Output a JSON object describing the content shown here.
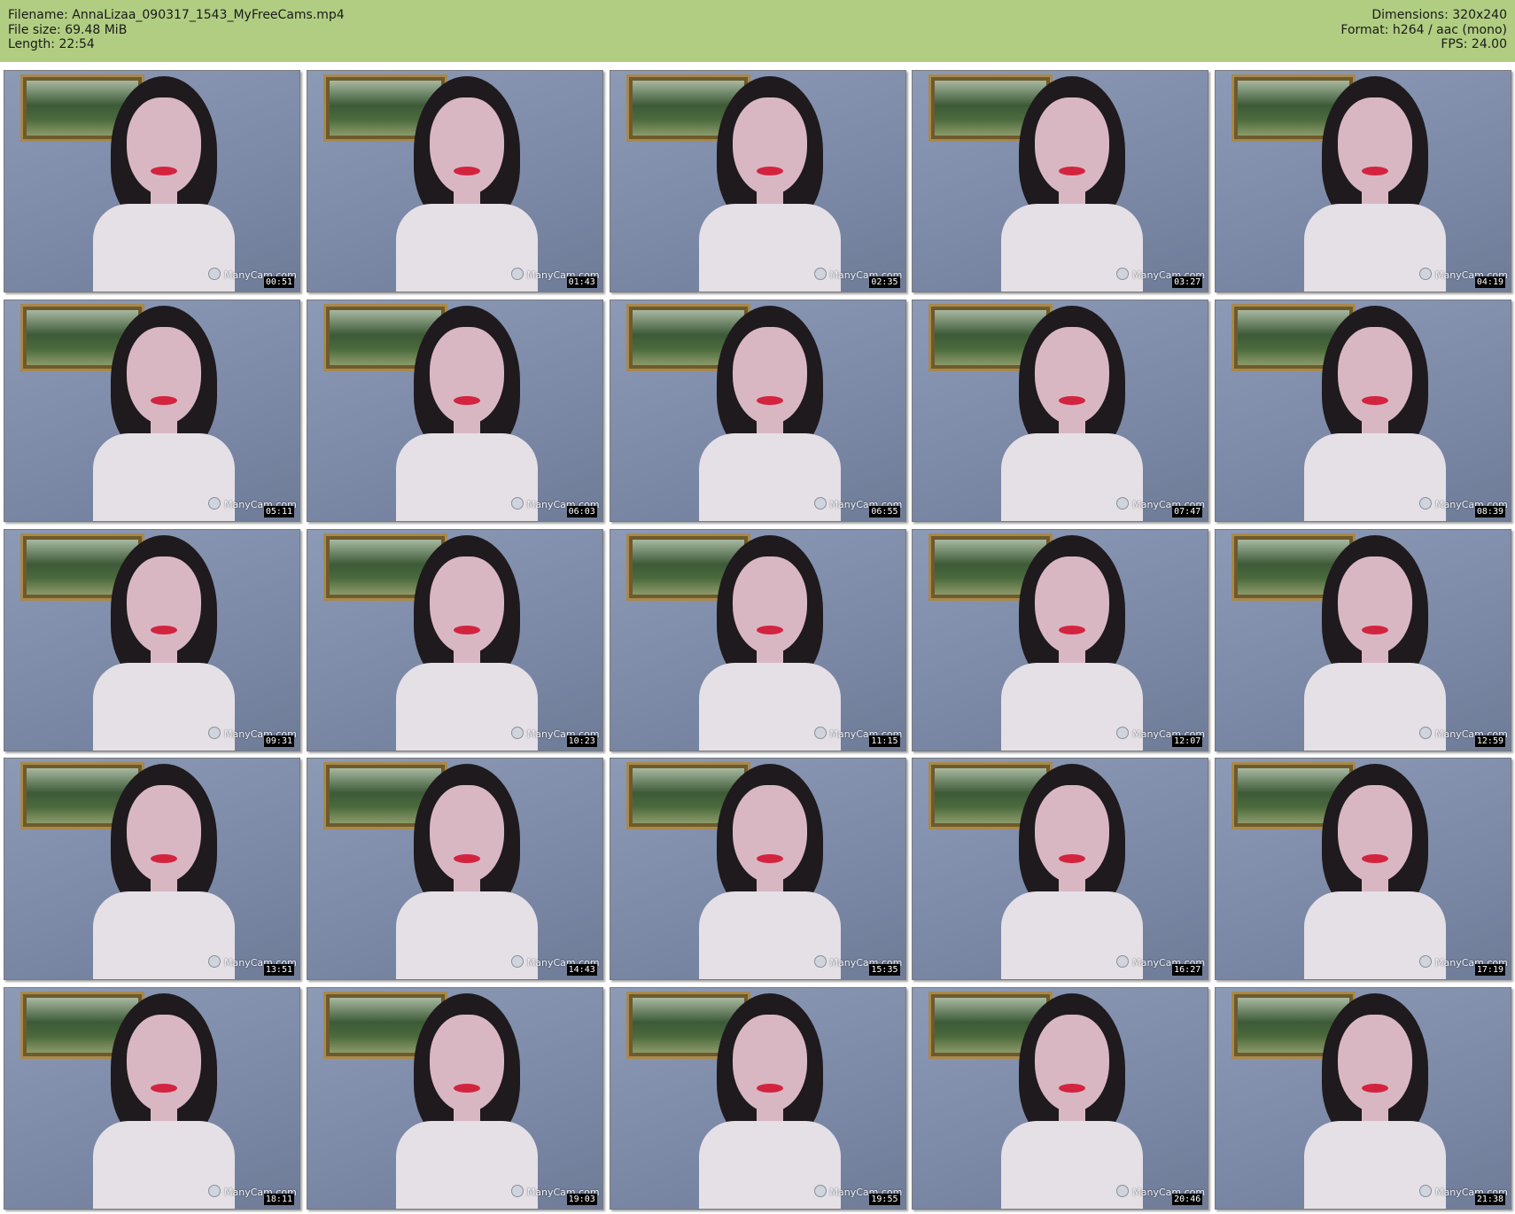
{
  "header": {
    "filename": "Filename: AnnaLizaa_090317_1543_MyFreeCams.mp4",
    "filesize": "File size: 69.48 MiB",
    "length": "Length: 22:54",
    "dimensions": "Dimensions: 320x240",
    "format": "Format: h264 / aac (mono)",
    "fps": "FPS: 24.00"
  },
  "colors": {
    "header_bg": "#b1cd82"
  },
  "thumbnails": [
    {
      "timestamp": "00:51",
      "watermark": "ManyCam.com"
    },
    {
      "timestamp": "01:43",
      "watermark": "ManyCam.com"
    },
    {
      "timestamp": "02:35",
      "watermark": "ManyCam.com"
    },
    {
      "timestamp": "03:27",
      "watermark": "ManyCam.com"
    },
    {
      "timestamp": "04:19",
      "watermark": "ManyCam.com"
    },
    {
      "timestamp": "05:11",
      "watermark": "ManyCam.com"
    },
    {
      "timestamp": "06:03",
      "watermark": "ManyCam.com"
    },
    {
      "timestamp": "06:55",
      "watermark": "ManyCam.com"
    },
    {
      "timestamp": "07:47",
      "watermark": "ManyCam.com"
    },
    {
      "timestamp": "08:39",
      "watermark": "ManyCam.com"
    },
    {
      "timestamp": "09:31",
      "watermark": "ManyCam.com"
    },
    {
      "timestamp": "10:23",
      "watermark": "ManyCam.com"
    },
    {
      "timestamp": "11:15",
      "watermark": "ManyCam.com"
    },
    {
      "timestamp": "12:07",
      "watermark": "ManyCam.com"
    },
    {
      "timestamp": "12:59",
      "watermark": "ManyCam.com"
    },
    {
      "timestamp": "13:51",
      "watermark": "ManyCam.com"
    },
    {
      "timestamp": "14:43",
      "watermark": "ManyCam.com"
    },
    {
      "timestamp": "15:35",
      "watermark": "ManyCam.com"
    },
    {
      "timestamp": "16:27",
      "watermark": "ManyCam.com"
    },
    {
      "timestamp": "17:19",
      "watermark": "ManyCam.com"
    },
    {
      "timestamp": "18:11",
      "watermark": "ManyCam.com"
    },
    {
      "timestamp": "19:03",
      "watermark": "ManyCam.com"
    },
    {
      "timestamp": "19:55",
      "watermark": "ManyCam.com"
    },
    {
      "timestamp": "20:46",
      "watermark": "ManyCam.com"
    },
    {
      "timestamp": "21:38",
      "watermark": "ManyCam.com"
    }
  ]
}
